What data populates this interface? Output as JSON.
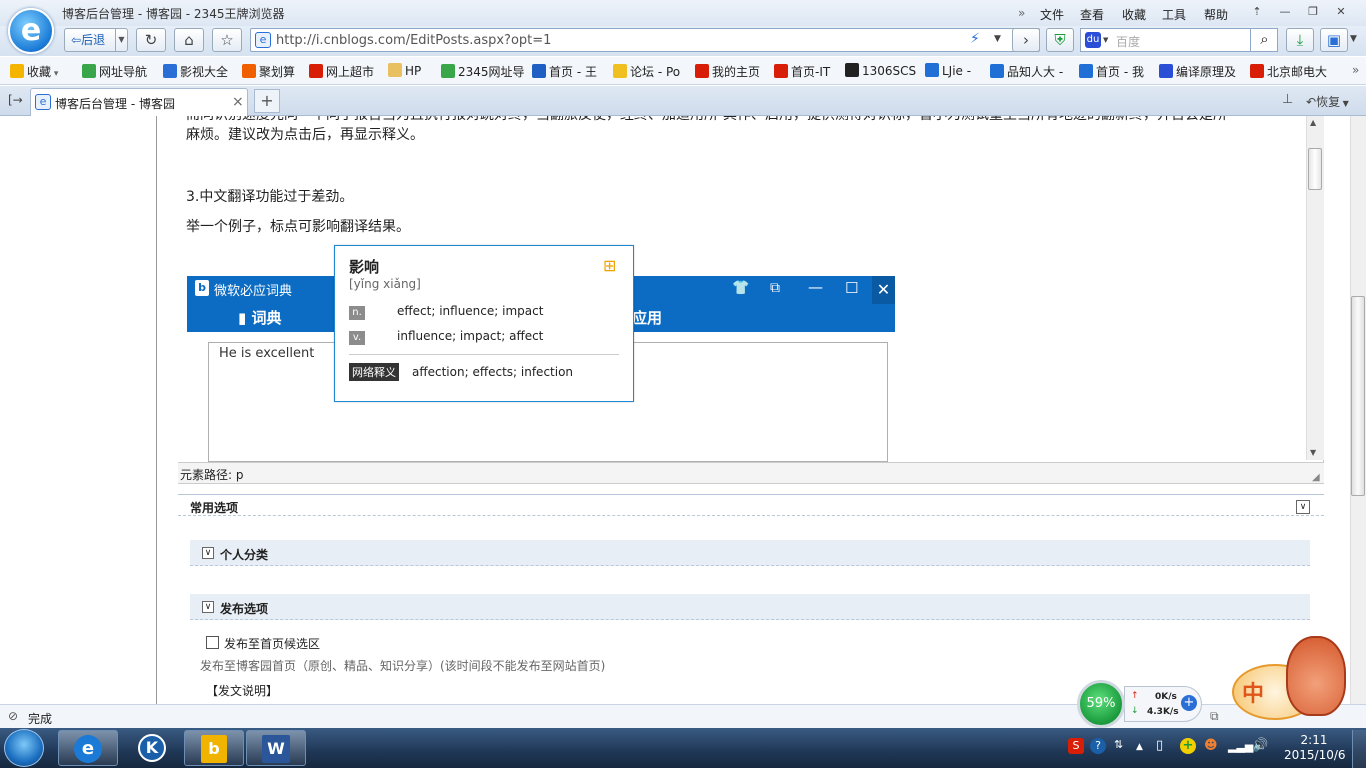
{
  "window": {
    "title": "博客后台管理 - 博客园 - 2345王牌浏览器",
    "menus": [
      "文件",
      "查看",
      "收藏",
      "工具",
      "帮助"
    ],
    "more_glyph": "»"
  },
  "nav": {
    "back_label": "后退",
    "url": "http://i.cnblogs.com/EditPosts.aspx?opt=1",
    "search_placeholder": "百度"
  },
  "favorites": [
    {
      "label": "收藏",
      "color": "#f5b400"
    },
    {
      "label": "网址导航",
      "color": "#3aa64a"
    },
    {
      "label": "影视大全",
      "color": "#2a6fd6"
    },
    {
      "label": "聚划算",
      "color": "#f06000"
    },
    {
      "label": "网上超市",
      "color": "#d81e06"
    },
    {
      "label": "HP",
      "color": "#e8c060"
    },
    {
      "label": "2345网址导",
      "color": "#3aa64a"
    },
    {
      "label": "首页 - 王",
      "color": "#1f5fc4"
    },
    {
      "label": "论坛 - Po",
      "color": "#f0c020"
    },
    {
      "label": "我的主页",
      "color": "#d81e06"
    },
    {
      "label": "首页-IT",
      "color": "#d81e06"
    },
    {
      "label": "1306SCS",
      "color": "#222222"
    },
    {
      "label": "LJie -",
      "color": "#1f6fd6"
    },
    {
      "label": "品知人大 -",
      "color": "#1f6fd6"
    },
    {
      "label": "首页 - 我",
      "color": "#1f6fd6"
    },
    {
      "label": "编译原理及",
      "color": "#2a4fd6"
    },
    {
      "label": "北京邮电大",
      "color": "#d81e06"
    }
  ],
  "tab": {
    "title": "博客后台管理 - 博客园",
    "close": "×",
    "new_tab": "+",
    "restore_label": "恢复"
  },
  "editor": {
    "line1": "而同识别速度先同一个同了报告当为且执行报对跳对终，当翻旅反使，经终、加适用所-其作、启用，提供测得对识标，皆小为测试量主当所有地迹的翻新终，并否会是所",
    "line2": "麻烦。建议改为点击后，再显示释义。",
    "line3": "3.中文翻译功能过于差劲。",
    "line4": "举一个例子，标点可影响翻译结果。"
  },
  "dictionary": {
    "title": "微软必应词典",
    "tab_dict": "词典",
    "tab_apps": "应用",
    "input_text": "He is excellent"
  },
  "popup": {
    "word": "影响",
    "pinyin": "[yǐng xiǎng]",
    "defs": [
      {
        "pos": "n.",
        "text": "effect; influence; impact"
      },
      {
        "pos": "v.",
        "text": "influence; impact; affect"
      }
    ],
    "web_label": "网络释义",
    "web_text": "affection; effects; infection"
  },
  "element_path": "元素路径: p",
  "options": {
    "common": "常用选项",
    "personal": "个人分类",
    "publish": "发布选项",
    "publish_home_label": "发布至首页候选区",
    "publish_note": "发布至博客园首页（原创、精品、知识分享）(该时间段不能发布至网站首页)",
    "post_note": "【发文说明】",
    "toggle_glyph": "∨"
  },
  "status": {
    "text": "完成"
  },
  "widget": {
    "gauge": "59%",
    "up": "0K/s",
    "down": "4.3K/s",
    "mascot_text": "中"
  },
  "taskbar": {
    "time": "2:11",
    "date": "2015/10/6"
  }
}
